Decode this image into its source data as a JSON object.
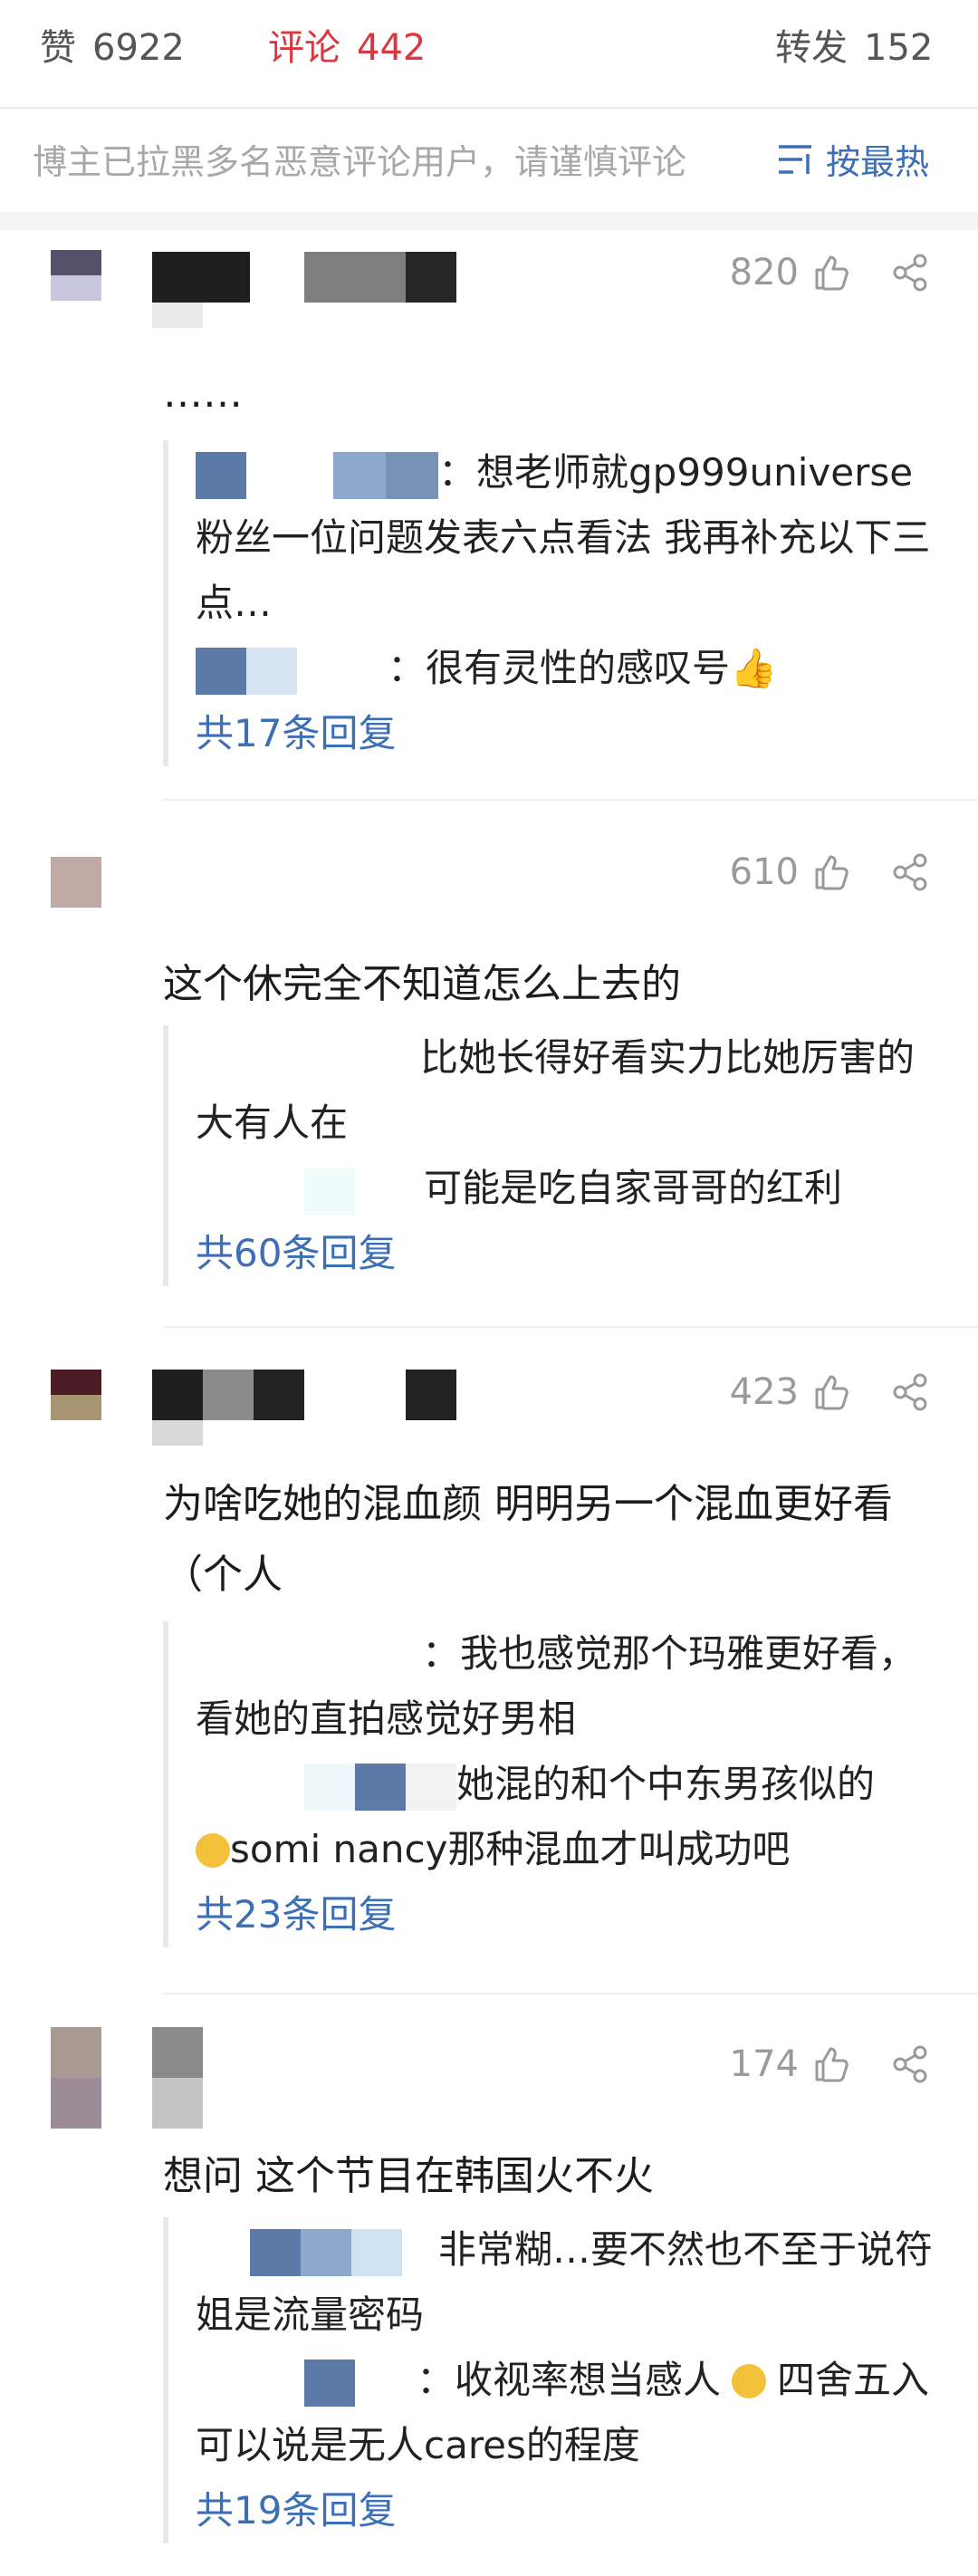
{
  "stats": {
    "like_label": "赞",
    "like_count": "6922",
    "comment_label": "评论",
    "comment_count": "442",
    "forward_label": "转发",
    "forward_count": "152"
  },
  "notice": "博主已拉黑多名恶意评论用户，请谨慎评论",
  "sort_label": "按最热",
  "colors": {
    "accent_red": "#d9383e",
    "link_blue": "#3d6fb6",
    "muted": "#9a9a9a"
  },
  "comments": [
    {
      "likes": "820",
      "text": "……",
      "replies": [
        {
          "text": "：想老师就gp999universe粉丝一位问题发表六点看法 我再补充以下三点…"
        },
        {
          "text": "：很有灵性的感叹号👍"
        }
      ],
      "more": "共17条回复"
    },
    {
      "likes": "610",
      "text": "这个休完全不知道怎么上去的",
      "replies": [
        {
          "text": "比她长得好看实力比她厉害的大有人在"
        },
        {
          "text": "可能是吃自家哥哥的红利"
        }
      ],
      "more": "共60条回复"
    },
    {
      "likes": "423",
      "text": "为啥吃她的混血颜 明明另一个混血更好看（个人",
      "replies": [
        {
          "text": "：我也感觉那个玛雅更好看，看她的直拍感觉好男相"
        },
        {
          "text": "她混的和个中东男孩似的"
        },
        {
          "text": "somi nancy那种混血才叫成功吧"
        }
      ],
      "more": "共23条回复"
    },
    {
      "likes": "174",
      "text": "想问 这个节目在韩国火不火",
      "replies": [
        {
          "text": "非常糊…要不然也不至于说符姐是流量密码"
        },
        {
          "text": "：收视率想当感人"
        },
        {
          "text": "四舍五入 可以说是无人cares的程度"
        }
      ],
      "more": "共19条回复"
    }
  ]
}
